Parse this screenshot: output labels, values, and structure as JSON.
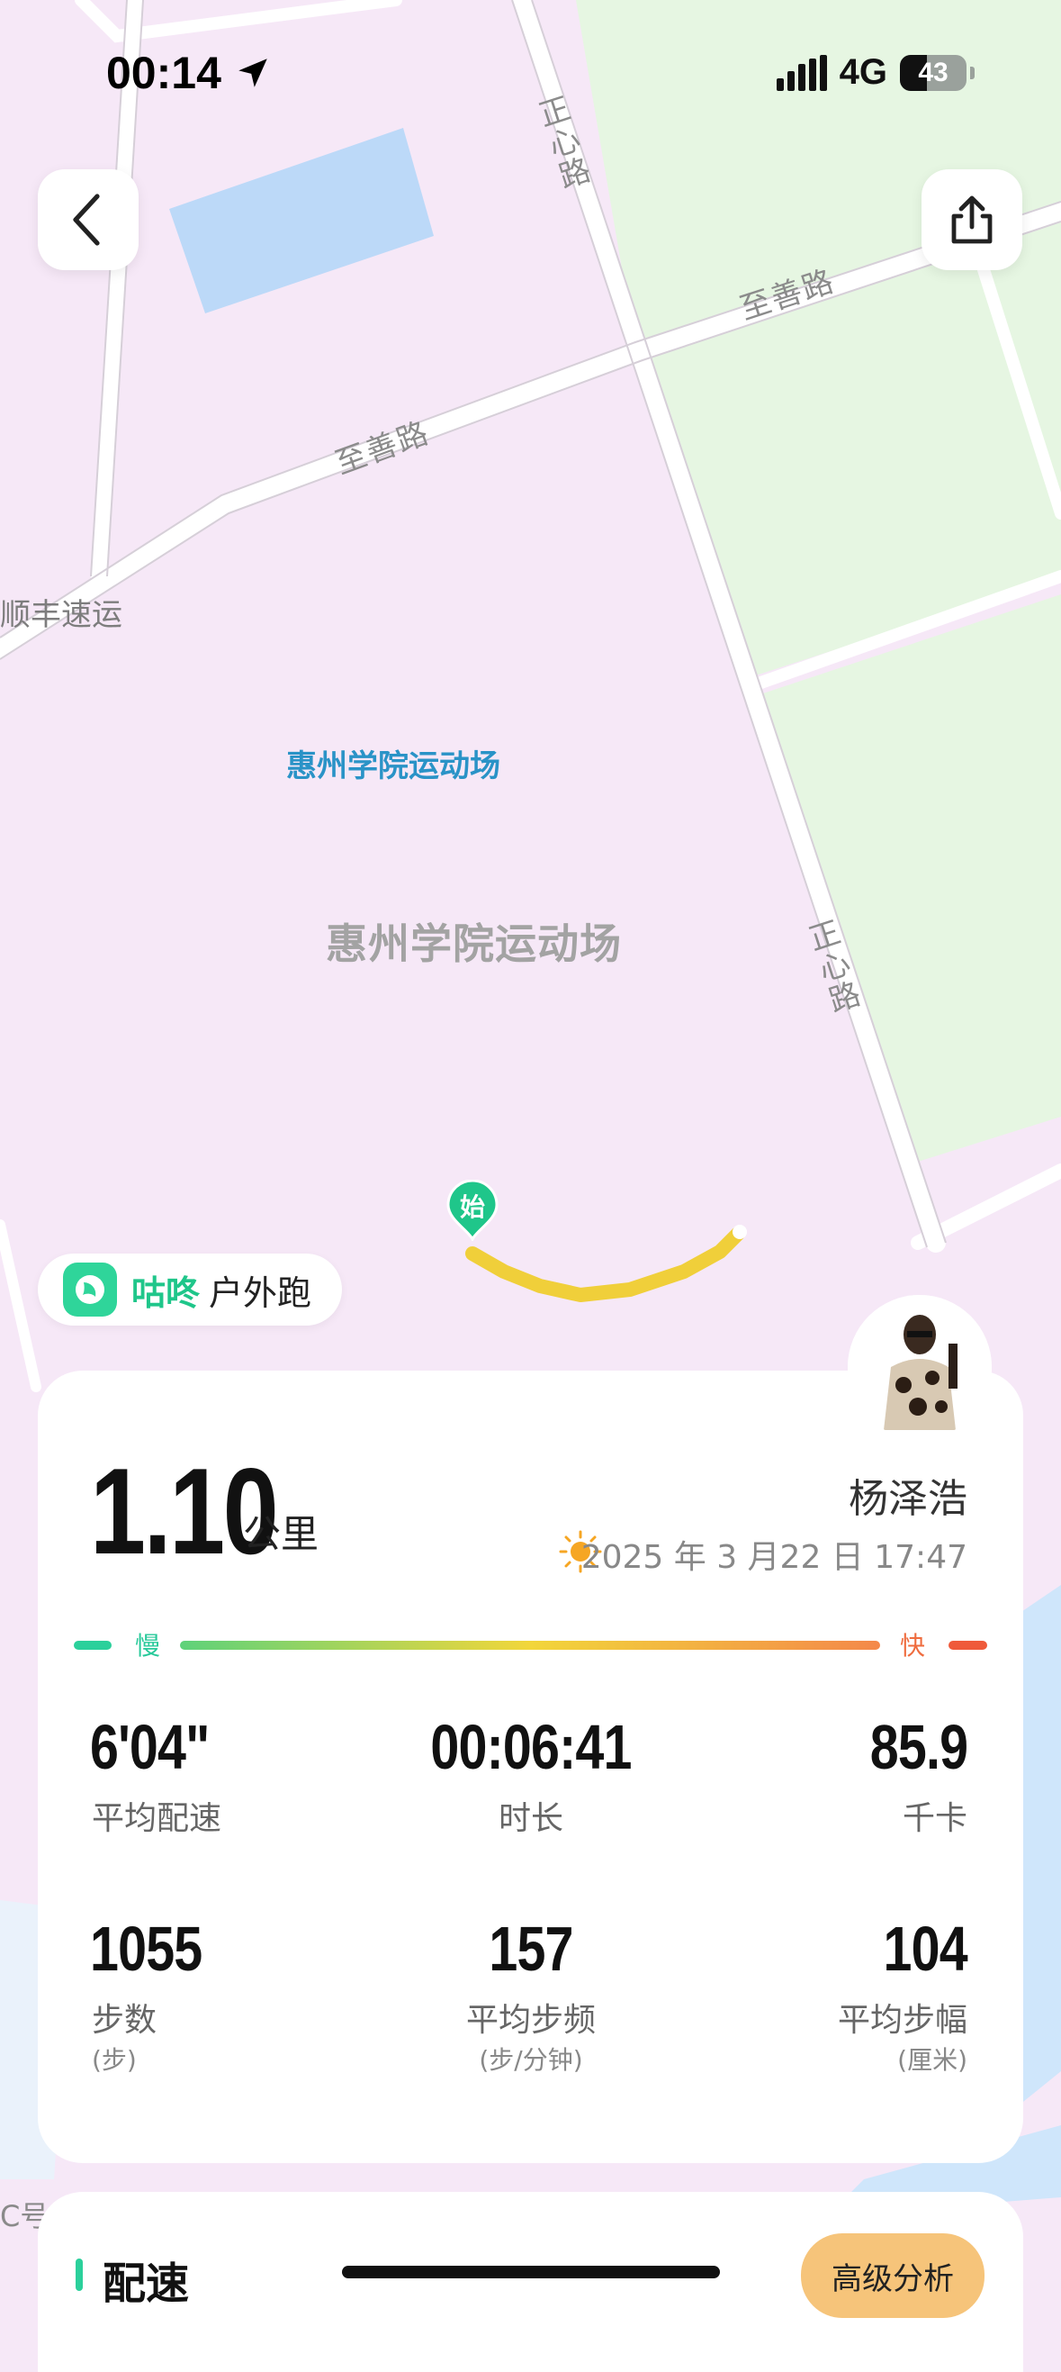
{
  "status_bar": {
    "time": "00:14",
    "network": "4G",
    "battery": "43"
  },
  "map": {
    "roads": {
      "zhengxin_top": "正心路",
      "zhishan_right": "至善路",
      "zhishan_left": "至善路",
      "zhengxin_bottom": "正心路"
    },
    "poi_blue": "惠州学院运动场",
    "area_name": "惠州学院运动场",
    "poi_left": "顺丰速运",
    "start_marker": "始",
    "bottom_left_label": "C号"
  },
  "app": {
    "name": "咕咚",
    "activity": "户外跑"
  },
  "summary": {
    "distance": "1.10",
    "distance_unit": "公里",
    "user_name": "杨泽浩",
    "date": "2025 年 3 月22 日 17:47",
    "speed_slow": "慢",
    "speed_fast": "快"
  },
  "stats": [
    {
      "value": "6'04\"",
      "label": "平均配速"
    },
    {
      "value": "00:06:41",
      "label": "时长"
    },
    {
      "value": "85.9",
      "label": "千卡"
    },
    {
      "value": "1055",
      "label": "步数",
      "unit": "(步)"
    },
    {
      "value": "157",
      "label": "平均步频",
      "unit": "(步/分钟)"
    },
    {
      "value": "104",
      "label": "平均步幅",
      "unit": "(厘米)"
    }
  ],
  "bottom": {
    "pace_title": "配速",
    "advanced_button": "高级分析"
  },
  "colors": {
    "accent_green": "#2bd09b",
    "map_pink": "#f6e8f7",
    "map_green": "#e6f6e2",
    "route": "#f0cf3a",
    "advanced_btn": "#f6c47a"
  }
}
